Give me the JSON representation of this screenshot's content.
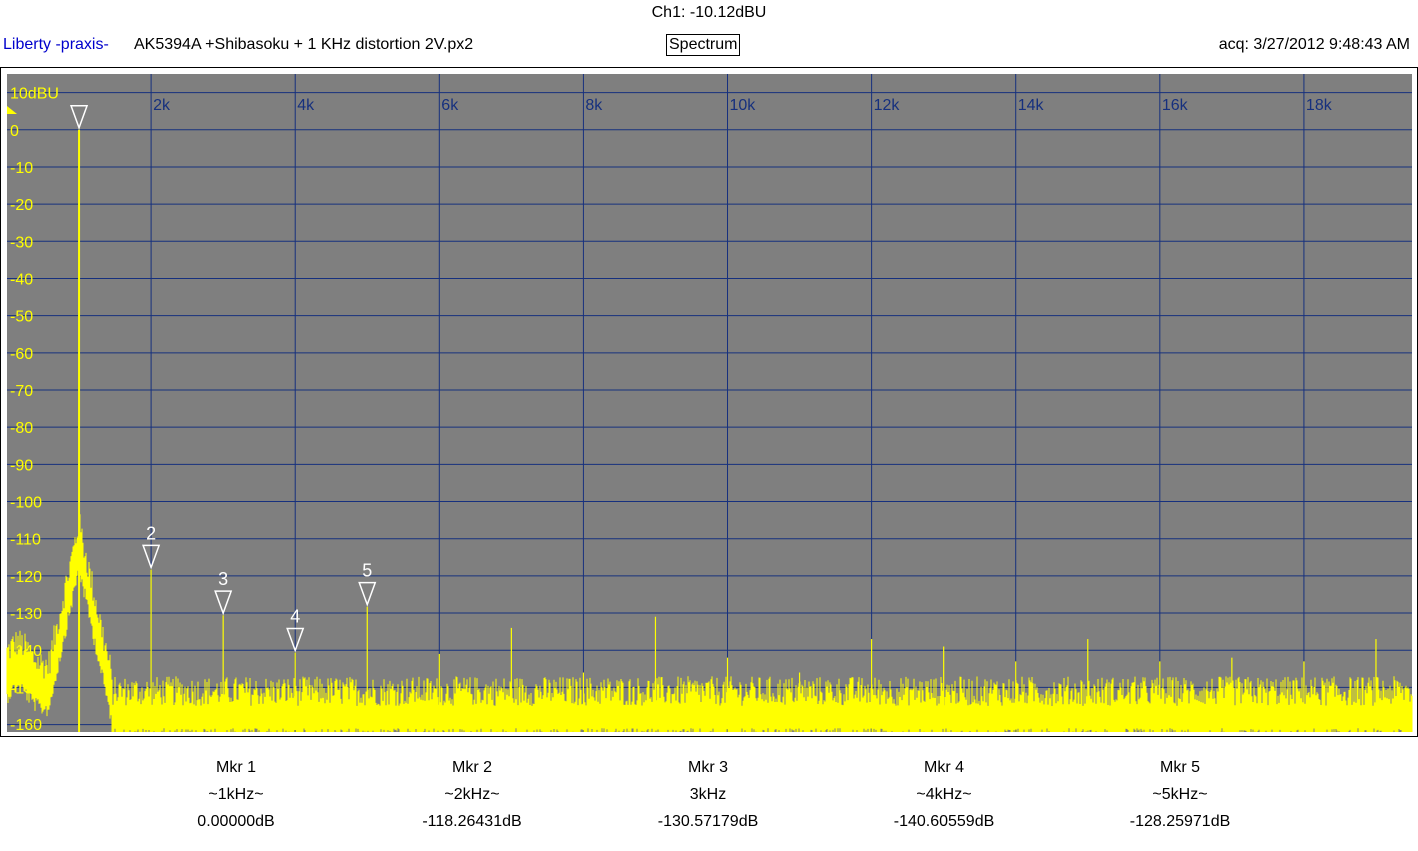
{
  "header": {
    "channel_readout": "Ch1: -10.12dBU",
    "brand": "Liberty -praxis-",
    "file_title": "AK5394A +Shibasoku + 1 KHz distortion 2V.px2",
    "view_mode": "Spectrum",
    "acquired": "acq: 3/27/2012 9:48:43 AM"
  },
  "colors": {
    "plot_bg": "#7f7f7f",
    "grid": "#16307e",
    "trace": "#ffff00",
    "marker": "#ffffff",
    "brand": "#0000cc"
  },
  "chart_data": {
    "type": "line",
    "view": "Spectrum",
    "xlim": [
      0,
      19500
    ],
    "ylim": [
      -162,
      15
    ],
    "x_ticks": [
      2000,
      4000,
      6000,
      8000,
      10000,
      12000,
      14000,
      16000,
      18000
    ],
    "x_tick_labels": [
      "2k",
      "4k",
      "6k",
      "8k",
      "10k",
      "12k",
      "14k",
      "16k",
      "18k"
    ],
    "y_ticks": [
      10,
      0,
      -10,
      -20,
      -30,
      -40,
      -50,
      -60,
      -70,
      -80,
      -90,
      -100,
      -110,
      -120,
      -130,
      -140,
      -150,
      -160
    ],
    "y_tick_labels": [
      "10dBU",
      "0",
      "-10",
      "-20",
      "-30",
      "-40",
      "-50",
      "-60",
      "-70",
      "-80",
      "-90",
      "-100",
      "-110",
      "-120",
      "-130",
      "-140",
      "-150",
      "-160"
    ],
    "grid": true,
    "noise_floor_db": -157,
    "fundamental": {
      "freq": 1000,
      "level_db": 0
    },
    "spurs": [
      {
        "freq": 2000,
        "level_db": -118.3
      },
      {
        "freq": 3000,
        "level_db": -130.6
      },
      {
        "freq": 4000,
        "level_db": -140.6
      },
      {
        "freq": 5000,
        "level_db": -128.3
      },
      {
        "freq": 6000,
        "level_db": -141
      },
      {
        "freq": 7000,
        "level_db": -134
      },
      {
        "freq": 8000,
        "level_db": -146
      },
      {
        "freq": 9000,
        "level_db": -131
      },
      {
        "freq": 10000,
        "level_db": -142
      },
      {
        "freq": 11000,
        "level_db": -146
      },
      {
        "freq": 12000,
        "level_db": -137
      },
      {
        "freq": 13000,
        "level_db": -139
      },
      {
        "freq": 14000,
        "level_db": -143
      },
      {
        "freq": 15000,
        "level_db": -137
      },
      {
        "freq": 16000,
        "level_db": -143
      },
      {
        "freq": 17000,
        "level_db": -142
      },
      {
        "freq": 18000,
        "level_db": -143
      },
      {
        "freq": 19000,
        "level_db": -137
      }
    ],
    "markers": [
      {
        "id": "1",
        "freq": 1000,
        "level_db": 0
      },
      {
        "id": "2",
        "freq": 2000,
        "level_db": -118.26431
      },
      {
        "id": "3",
        "freq": 3000,
        "level_db": -130.57179
      },
      {
        "id": "4",
        "freq": 4000,
        "level_db": -140.60559
      },
      {
        "id": "5",
        "freq": 5000,
        "level_db": -128.25971
      }
    ]
  },
  "marker_readouts": [
    {
      "label": "Mkr 1",
      "freq": "~1kHz~",
      "value": "0.00000dB"
    },
    {
      "label": "Mkr 2",
      "freq": "~2kHz~",
      "value": "-118.26431dB"
    },
    {
      "label": "Mkr 3",
      "freq": "3kHz",
      "value": "-130.57179dB"
    },
    {
      "label": "Mkr 4",
      "freq": "~4kHz~",
      "value": "-140.60559dB"
    },
    {
      "label": "Mkr 5",
      "freq": "~5kHz~",
      "value": "-128.25971dB"
    }
  ]
}
